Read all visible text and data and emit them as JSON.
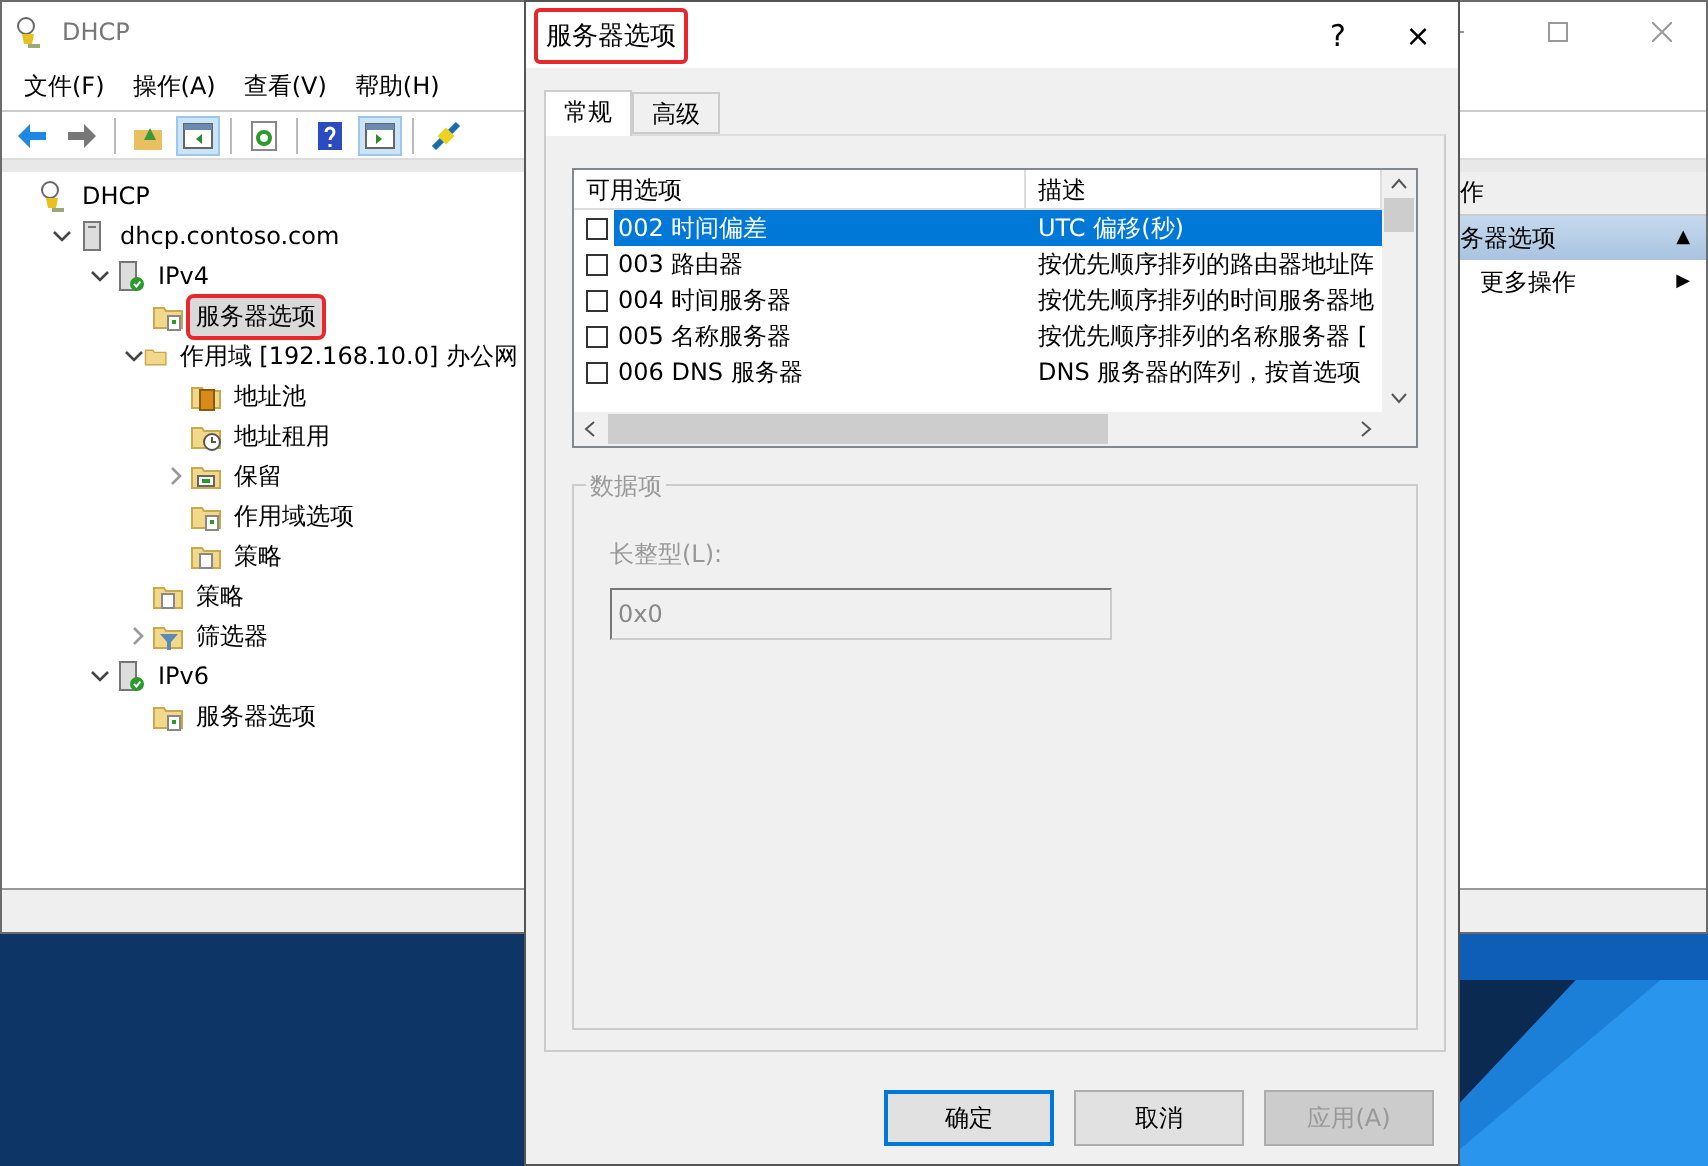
{
  "main_window": {
    "title": "DHCP",
    "menu": [
      "文件(F)",
      "操作(A)",
      "查看(V)",
      "帮助(H)"
    ],
    "toolbar": [
      {
        "kind": "back"
      },
      {
        "kind": "forward"
      },
      {
        "kind": "sep"
      },
      {
        "kind": "up"
      },
      {
        "kind": "tree",
        "pressed": true
      },
      {
        "kind": "sep"
      },
      {
        "kind": "refresh"
      },
      {
        "kind": "sep"
      },
      {
        "kind": "help"
      },
      {
        "kind": "actions",
        "pressed": true
      },
      {
        "kind": "sep"
      },
      {
        "kind": "plug"
      }
    ],
    "tree": [
      {
        "label": "DHCP",
        "kind": "dhcp",
        "selected": false,
        "children": [
          {
            "label": "dhcp.contoso.com",
            "kind": "server",
            "expanded": true,
            "selected": false,
            "children": [
              {
                "label": "IPv4",
                "kind": "server-ok",
                "expanded": true,
                "selected": false,
                "children": [
                  {
                    "label": "服务器选项",
                    "kind": "folder-options",
                    "selected": true,
                    "highlighted": true
                  },
                  {
                    "label": "作用域 [192.168.10.0] 办公网",
                    "kind": "folder",
                    "expanded": true,
                    "selected": false,
                    "children": [
                      {
                        "label": "地址池",
                        "kind": "folder-pool",
                        "selected": false
                      },
                      {
                        "label": "地址租用",
                        "kind": "folder-clock",
                        "selected": false
                      },
                      {
                        "label": "保留",
                        "kind": "folder-grid",
                        "expanded": false,
                        "selected": false
                      },
                      {
                        "label": "作用域选项",
                        "kind": "folder-options",
                        "selected": false
                      },
                      {
                        "label": "策略",
                        "kind": "folder-doc",
                        "selected": false
                      }
                    ]
                  },
                  {
                    "label": "策略",
                    "kind": "folder-doc",
                    "selected": false
                  },
                  {
                    "label": "筛选器",
                    "kind": "folder-filter",
                    "expanded": false,
                    "selected": false
                  }
                ]
              },
              {
                "label": "IPv6",
                "kind": "server-ok",
                "expanded": true,
                "selected": false,
                "children": [
                  {
                    "label": "服务器选项",
                    "kind": "folder-options",
                    "selected": false
                  }
                ]
              }
            ]
          }
        ]
      }
    ],
    "actions": {
      "header": "作",
      "items": [
        {
          "label": "务器选项",
          "kind": "section",
          "arrow": "▲"
        },
        {
          "label": "更多操作",
          "kind": "item",
          "arrow": "▶"
        }
      ]
    }
  },
  "dialog": {
    "title": "服务器选项",
    "highlighted": true,
    "help": "?",
    "close": "×",
    "tabs": [
      {
        "label": "常规",
        "selected": true
      },
      {
        "label": "高级",
        "selected": false
      }
    ],
    "options": {
      "columns": [
        "可用选项",
        "描述"
      ],
      "rows": [
        {
          "name": "002 时间偏差",
          "description": "UTC 偏移(秒)",
          "checked": false,
          "selected": true
        },
        {
          "name": "003 路由器",
          "description": "按优先顺序排列的路由器地址阵",
          "checked": false,
          "selected": false
        },
        {
          "name": "004 时间服务器",
          "description": "按优先顺序排列的时间服务器地",
          "checked": false,
          "selected": false
        },
        {
          "name": "005 名称服务器",
          "description": "按优先顺序排列的名称服务器 [",
          "checked": false,
          "selected": false
        },
        {
          "name": "006 DNS 服务器",
          "description": "DNS 服务器的阵列，按首选项",
          "checked": false,
          "selected": false
        }
      ]
    },
    "data_group": {
      "title": "数据项",
      "label": "长整型(L):",
      "value": "0x0",
      "disabled": true
    },
    "buttons": [
      {
        "label": "确定",
        "kind": "default",
        "disabled": false
      },
      {
        "label": "取消",
        "kind": "normal",
        "disabled": false
      },
      {
        "label": "应用(A)",
        "kind": "normal",
        "disabled": true
      }
    ]
  }
}
